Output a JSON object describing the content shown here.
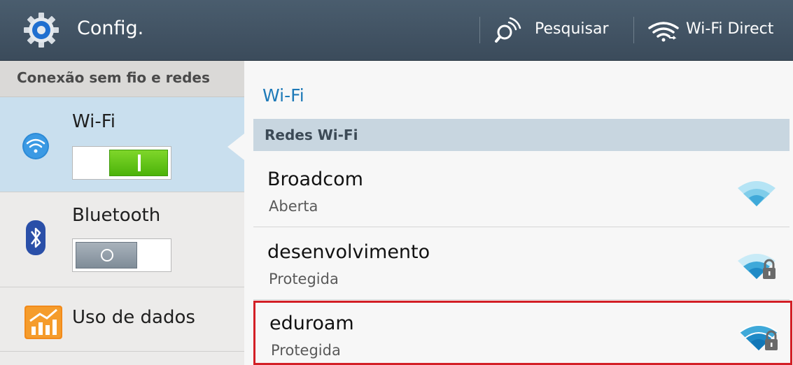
{
  "header": {
    "title": "Config.",
    "actions": [
      {
        "label": "Pesquisar",
        "icon": "search-icon"
      },
      {
        "label": "Wi-Fi Direct",
        "icon": "wifi-direct-icon"
      }
    ]
  },
  "sidebar": {
    "section_title": "Conexão sem fio e redes",
    "items": [
      {
        "label": "Wi-Fi",
        "icon": "wifi-icon",
        "toggle": "on",
        "selected": true
      },
      {
        "label": "Bluetooth",
        "icon": "bluetooth-icon",
        "toggle": "off"
      },
      {
        "label": "Uso de dados",
        "icon": "data-usage-icon"
      }
    ]
  },
  "main": {
    "title": "Wi-Fi",
    "section_header": "Redes Wi-Fi",
    "networks": [
      {
        "name": "Broadcom",
        "status": "Aberta",
        "icon": "wifi-signal-icon",
        "locked": false
      },
      {
        "name": "desenvolvimento",
        "status": "Protegida",
        "icon": "wifi-signal-lock-icon",
        "locked": true
      },
      {
        "name": "eduroam",
        "status": "Protegida",
        "icon": "wifi-signal-lock-icon",
        "locked": true,
        "highlighted": true
      }
    ]
  },
  "colors": {
    "header_bg": "#3f5061",
    "accent_blue": "#1e7ab8",
    "toggle_on": "#5cc214",
    "highlight_border": "#d31f26",
    "selected_item_bg": "#c9dfee"
  }
}
